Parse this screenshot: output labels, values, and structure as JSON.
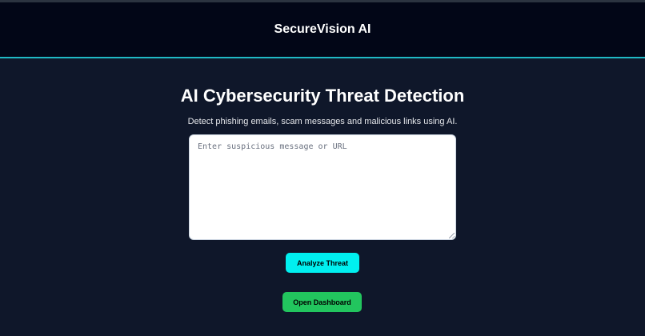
{
  "header": {
    "brand": "SecureVision AI"
  },
  "main": {
    "title": "AI Cybersecurity Threat Detection",
    "subtitle": "Detect phishing emails, scam messages and malicious links using AI.",
    "input": {
      "value": "",
      "placeholder": "Enter suspicious message or URL"
    },
    "analyze_label": "Analyze Threat",
    "dashboard_label": "Open Dashboard"
  },
  "colors": {
    "page_bg": "#0f172a",
    "header_bg": "#020617",
    "accent_border": "#1fb8c4",
    "analyze_button": "#00f0f0",
    "dashboard_button": "#22c55e"
  }
}
